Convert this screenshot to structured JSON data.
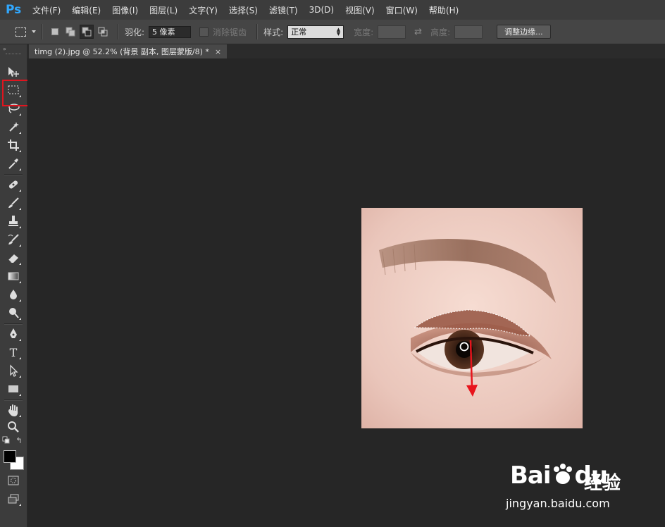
{
  "app": {
    "logo": "Ps"
  },
  "menu": [
    "文件(F)",
    "编辑(E)",
    "图像(I)",
    "图层(L)",
    "文字(Y)",
    "选择(S)",
    "滤镜(T)",
    "3D(D)",
    "视图(V)",
    "窗口(W)",
    "帮助(H)"
  ],
  "options": {
    "feather_label": "羽化:",
    "feather_value": "5 像素",
    "antialias_label": "消除锯齿",
    "style_label": "样式:",
    "style_value": "正常",
    "width_label": "宽度:",
    "height_label": "高度:",
    "refine_edge_label": "调整边缘..."
  },
  "document": {
    "tab_title": "timg (2).jpg @ 52.2% (背景 副本, 图层蒙版/8) *"
  },
  "tools": [
    "move-tool",
    "rectangular-marquee-tool",
    "lasso-tool",
    "magic-wand-tool",
    "crop-tool",
    "eyedropper-tool",
    "healing-brush-tool",
    "brush-tool",
    "clone-stamp-tool",
    "history-brush-tool",
    "eraser-tool",
    "gradient-tool",
    "blur-tool",
    "dodge-tool",
    "pen-tool",
    "type-tool",
    "path-selection-tool",
    "rectangle-tool",
    "hand-tool",
    "zoom-tool",
    "quick-mask-mode",
    "screen-mode"
  ],
  "type_tool_glyph": "T",
  "colors": {
    "foreground": "#000000",
    "background": "#ffffff",
    "highlight": "#e0141e",
    "arrow": "#e8141c"
  },
  "watermark": {
    "brand": "Bai",
    "brand2": "du",
    "service": "经验",
    "url": "jingyan.baidu.com"
  }
}
